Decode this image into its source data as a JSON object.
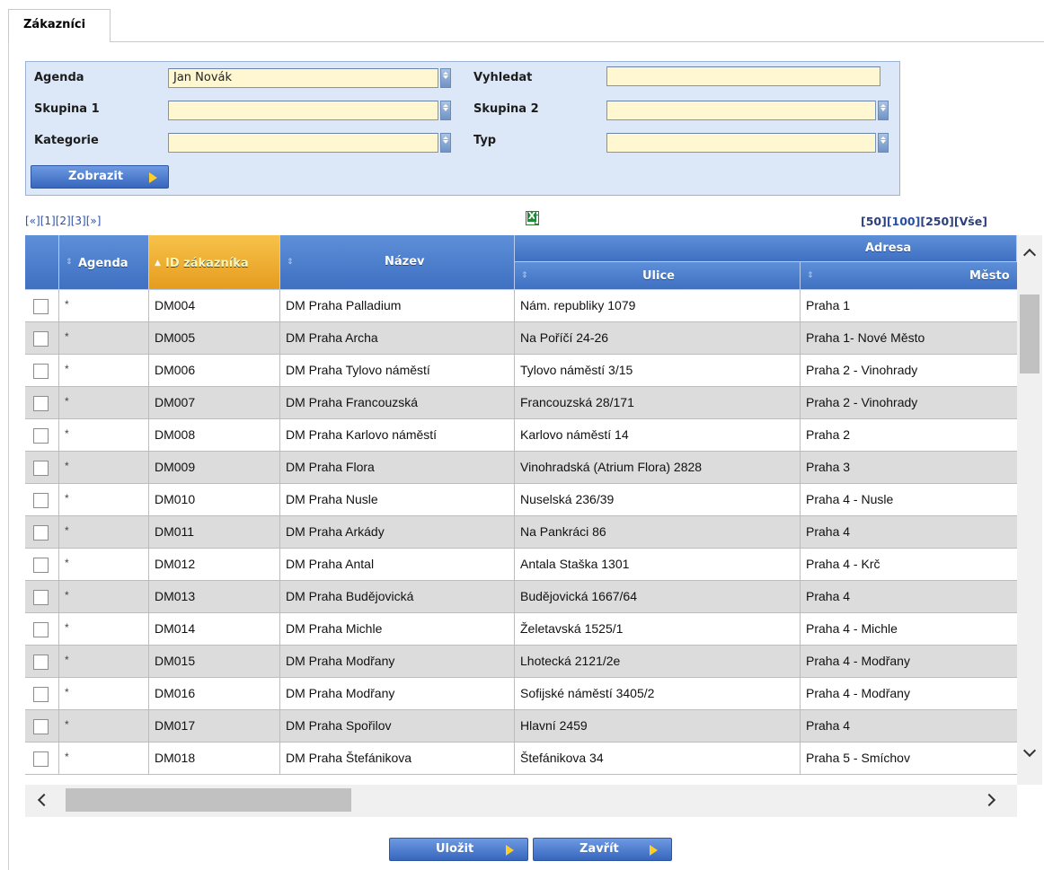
{
  "tabs": [
    {
      "label": "Zákazníci",
      "active": true
    }
  ],
  "filter": {
    "agenda_label": "Agenda",
    "agenda_value": "Jan Novák",
    "vyhledat_label": "Vyhledat",
    "vyhledat_value": "",
    "skupina1_label": "Skupina 1",
    "skupina1_value": "",
    "skupina2_label": "Skupina 2",
    "skupina2_value": "",
    "kategorie_label": "Kategorie",
    "kategorie_value": "",
    "typ_label": "Typ",
    "typ_value": "",
    "show_button": "Zobrazit"
  },
  "pager": {
    "first": "[«]",
    "pages": [
      "[1]",
      "[2]",
      "[3]"
    ],
    "last": "[»]",
    "page_sizes": [
      "[50]",
      "[100]",
      "[250]",
      "[Vše]"
    ]
  },
  "table": {
    "group_header": "Adresa",
    "columns": {
      "agenda": "Agenda",
      "id": "ID zákazníka",
      "nazev": "Název",
      "ulice": "Ulice",
      "mesto": "Město"
    },
    "sorted_column": "ID zákazníka",
    "rows": [
      {
        "agenda": "*",
        "id": "DM004",
        "nazev": "DM Praha Palladium",
        "ulice": "Nám. republiky 1079",
        "mesto": "Praha 1"
      },
      {
        "agenda": "*",
        "id": "DM005",
        "nazev": "DM Praha Archa",
        "ulice": "Na Poříčí 24-26",
        "mesto": "Praha 1- Nové Město"
      },
      {
        "agenda": "*",
        "id": "DM006",
        "nazev": "DM Praha Tylovo náměstí",
        "ulice": "Tylovo náměstí 3/15",
        "mesto": "Praha 2 - Vinohrady"
      },
      {
        "agenda": "*",
        "id": "DM007",
        "nazev": "DM Praha Francouzská",
        "ulice": "Francouzská 28/171",
        "mesto": "Praha 2 - Vinohrady"
      },
      {
        "agenda": "*",
        "id": "DM008",
        "nazev": "DM Praha Karlovo náměstí",
        "ulice": "Karlovo náměstí 14",
        "mesto": "Praha 2"
      },
      {
        "agenda": "*",
        "id": "DM009",
        "nazev": "DM Praha Flora",
        "ulice": "Vinohradská (Atrium Flora) 2828",
        "mesto": "Praha 3"
      },
      {
        "agenda": "*",
        "id": "DM010",
        "nazev": "DM Praha Nusle",
        "ulice": "Nuselská 236/39",
        "mesto": "Praha 4 - Nusle"
      },
      {
        "agenda": "*",
        "id": "DM011",
        "nazev": "DM Praha Arkády",
        "ulice": "Na Pankráci 86",
        "mesto": "Praha 4"
      },
      {
        "agenda": "*",
        "id": "DM012",
        "nazev": "DM Praha Antal",
        "ulice": "Antala Staška 1301",
        "mesto": "Praha 4 - Krč"
      },
      {
        "agenda": "*",
        "id": "DM013",
        "nazev": "DM Praha Budějovická",
        "ulice": "Budějovická 1667/64",
        "mesto": "Praha 4"
      },
      {
        "agenda": "*",
        "id": "DM014",
        "nazev": "DM Praha Michle",
        "ulice": "Želetavská 1525/1",
        "mesto": "Praha 4 - Michle"
      },
      {
        "agenda": "*",
        "id": "DM015",
        "nazev": "DM Praha Modřany",
        "ulice": "Lhotecká 2121/2e",
        "mesto": "Praha 4 - Modřany"
      },
      {
        "agenda": "*",
        "id": "DM016",
        "nazev": "DM Praha Modřany",
        "ulice": "Sofijské náměstí 3405/2",
        "mesto": "Praha 4 - Modřany"
      },
      {
        "agenda": "*",
        "id": "DM017",
        "nazev": "DM Praha Spořilov",
        "ulice": "Hlavní 2459",
        "mesto": "Praha 4"
      },
      {
        "agenda": "*",
        "id": "DM018",
        "nazev": "DM Praha Štefánikova",
        "ulice": "Štefánikova 34",
        "mesto": "Praha 5 - Smíchov"
      }
    ]
  },
  "footer": {
    "save_button": "Uložit",
    "close_button": "Zavřít"
  },
  "colors": {
    "header_blue": "#4a7ccb",
    "sorted_header": "#f0b437",
    "input_bg": "#fff7d1",
    "filter_bg": "#dce8f7",
    "button_arrow": "#ffcf26"
  },
  "icons": [
    "dropdown-arrow-icon",
    "excel-export-icon",
    "sort-icon",
    "checkbox-icon",
    "chevron-up-icon",
    "chevron-down-icon",
    "chevron-left-icon",
    "chevron-right-icon",
    "button-arrow-icon"
  ]
}
